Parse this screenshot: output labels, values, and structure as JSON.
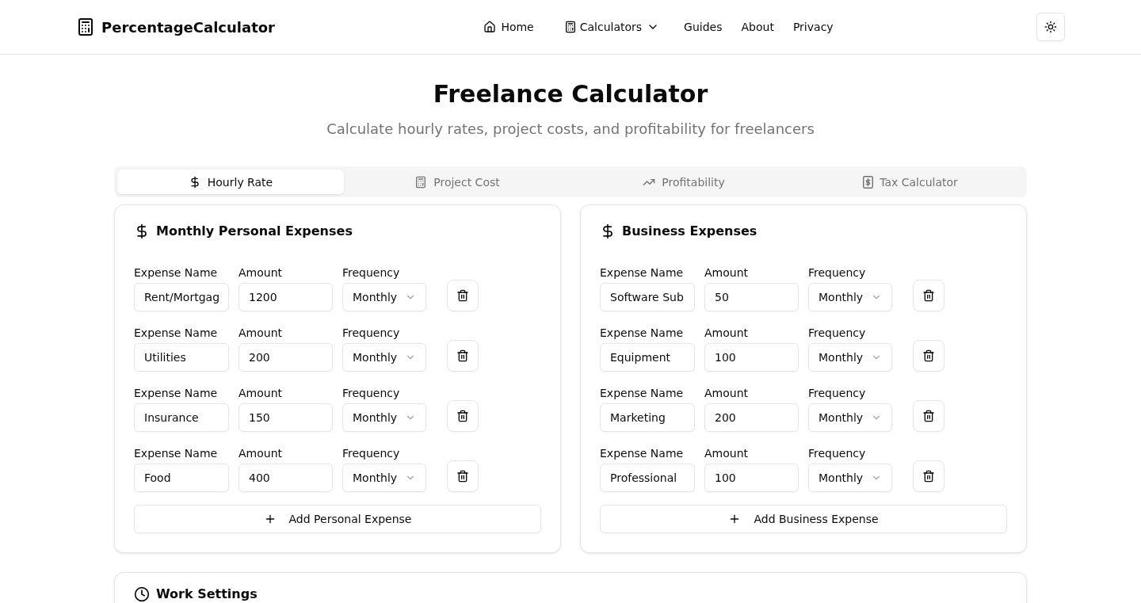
{
  "header": {
    "logo": "PercentageCalculator",
    "nav": [
      {
        "kind": "home",
        "label": "Home"
      },
      {
        "kind": "dropdown",
        "label": "Calculators"
      },
      {
        "kind": "link",
        "label": "Guides"
      },
      {
        "kind": "link",
        "label": "About"
      },
      {
        "kind": "link",
        "label": "Privacy"
      }
    ]
  },
  "page": {
    "title": "Freelance Calculator",
    "subtitle": "Calculate hourly rates, project costs, and profitability for freelancers"
  },
  "tabs": [
    {
      "kind": "dollar",
      "label": "Hourly Rate",
      "selected": true
    },
    {
      "kind": "calculator",
      "label": "Project Cost",
      "selected": false
    },
    {
      "kind": "trend",
      "label": "Profitability",
      "selected": false
    },
    {
      "kind": "tax",
      "label": "Tax Calculator",
      "selected": false
    }
  ],
  "expense_sections": [
    {
      "title": "Monthly Personal Expenses",
      "rows": [
        {
          "name_label": "Expense Name",
          "name": "Rent/Mortgag",
          "amount_label": "Amount",
          "amount": "1200",
          "frequency_label": "Frequency",
          "frequency": "Monthly"
        },
        {
          "name_label": "Expense Name",
          "name": "Utilities",
          "amount_label": "Amount",
          "amount": "200",
          "frequency_label": "Frequency",
          "frequency": "Monthly"
        },
        {
          "name_label": "Expense Name",
          "name": "Insurance",
          "amount_label": "Amount",
          "amount": "150",
          "frequency_label": "Frequency",
          "frequency": "Monthly"
        },
        {
          "name_label": "Expense Name",
          "name": "Food",
          "amount_label": "Amount",
          "amount": "400",
          "frequency_label": "Frequency",
          "frequency": "Monthly"
        }
      ],
      "add_button": "Add Personal Expense"
    },
    {
      "title": "Business Expenses",
      "rows": [
        {
          "name_label": "Expense Name",
          "name": "Software Sub",
          "amount_label": "Amount",
          "amount": "50",
          "frequency_label": "Frequency",
          "frequency": "Monthly"
        },
        {
          "name_label": "Expense Name",
          "name": "Equipment",
          "amount_label": "Amount",
          "amount": "100",
          "frequency_label": "Frequency",
          "frequency": "Monthly"
        },
        {
          "name_label": "Expense Name",
          "name": "Marketing",
          "amount_label": "Amount",
          "amount": "200",
          "frequency_label": "Frequency",
          "frequency": "Monthly"
        },
        {
          "name_label": "Expense Name",
          "name": "Professional",
          "amount_label": "Amount",
          "amount": "100",
          "frequency_label": "Frequency",
          "frequency": "Monthly"
        }
      ],
      "add_button": "Add Business Expense"
    }
  ],
  "work_settings": {
    "title": "Work Settings"
  }
}
